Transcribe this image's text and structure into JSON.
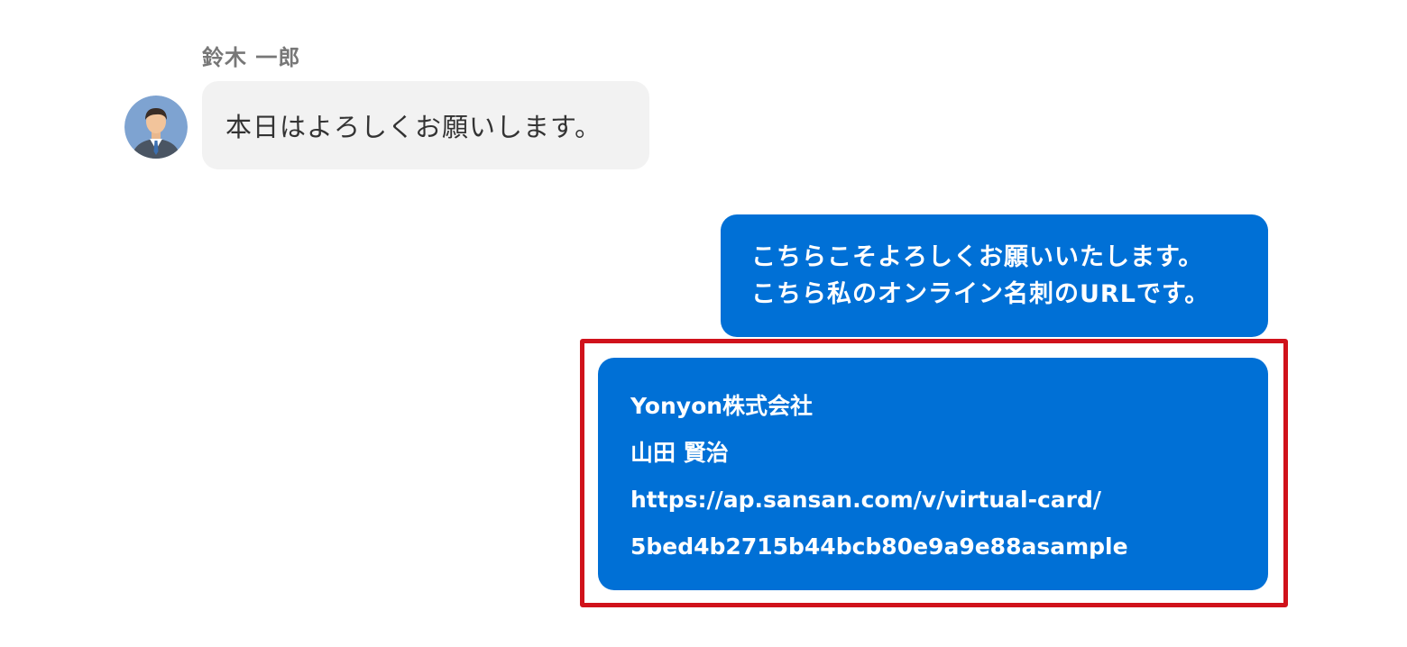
{
  "incoming": {
    "sender_name": "鈴木 一郎",
    "message": "本日はよろしくお願いします。",
    "avatar_icon": "person-avatar-icon"
  },
  "outgoing": {
    "lines": [
      "こちらこそよろしくお願いいたします。",
      "こちら私のオンライン名刺のURLです。"
    ]
  },
  "card_message": {
    "company": "Yonyon株式会社",
    "name": "山田 賢治",
    "url_line1": "https://ap.sansan.com/v/virtual-card/",
    "url_line2": "5bed4b2715b44bcb80e9a9e88asample"
  },
  "colors": {
    "outgoing_bubble": "#0070d6",
    "incoming_bubble": "#f2f2f2",
    "highlight": "#d0121b"
  }
}
